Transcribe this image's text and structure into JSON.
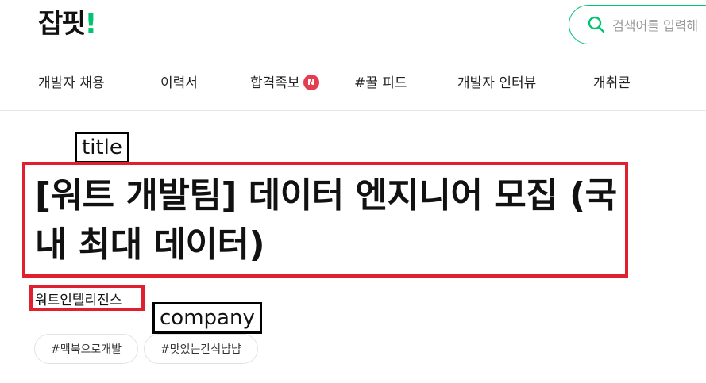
{
  "header": {
    "logo_text": "잡핏",
    "logo_dot": "!",
    "search": {
      "placeholder": "검색어를 입력해",
      "icon": "search-icon"
    }
  },
  "nav": {
    "items": [
      {
        "label": "개발자 채용"
      },
      {
        "label": "이력서"
      },
      {
        "label": "합격족보",
        "badge": "N"
      },
      {
        "label": "#꿀 피드"
      },
      {
        "label": "개발자 인터뷰"
      },
      {
        "label": "개취콘"
      }
    ]
  },
  "post": {
    "title": "[워트 개발팀] 데이터 엔지니어 모집 (국내 최대 데이터)",
    "company": "워트인텔리전스",
    "tags": [
      "#맥북으로개발",
      "#맛있는간식냠냠"
    ]
  },
  "annotations": {
    "title_label": "title",
    "company_label": "company"
  },
  "colors": {
    "accent": "#00c471",
    "badge": "#e43d4f",
    "annotation_box": "#e0202e"
  }
}
